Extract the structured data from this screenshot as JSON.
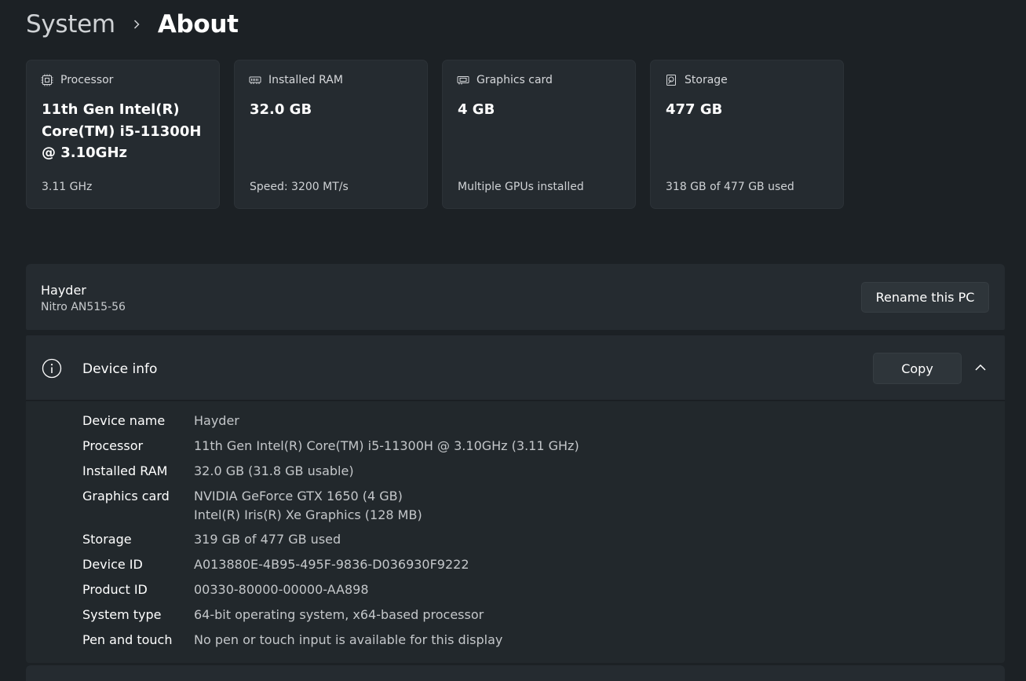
{
  "breadcrumb": {
    "parent": "System",
    "current": "About"
  },
  "cards": [
    {
      "label": "Processor",
      "value": "11th Gen Intel(R) Core(TM) i5-11300H @ 3.10GHz",
      "sub": "3.11 GHz",
      "icon": "processor-icon"
    },
    {
      "label": "Installed RAM",
      "value": "32.0 GB",
      "sub": "Speed: 3200 MT/s",
      "icon": "ram-icon"
    },
    {
      "label": "Graphics card",
      "value": "4 GB",
      "sub": "Multiple GPUs installed",
      "icon": "graphics-card-icon"
    },
    {
      "label": "Storage",
      "value": "477 GB",
      "sub": "318 GB of 477 GB used",
      "icon": "storage-icon"
    }
  ],
  "pc": {
    "name": "Hayder",
    "model": "Nitro AN515-56",
    "rename_label": "Rename this PC"
  },
  "device_info": {
    "title": "Device info",
    "copy_label": "Copy",
    "rows": [
      {
        "label": "Device name",
        "value": "Hayder"
      },
      {
        "label": "Processor",
        "value": "11th Gen Intel(R) Core(TM) i5-11300H @ 3.10GHz (3.11 GHz)"
      },
      {
        "label": "Installed RAM",
        "value": "32.0 GB (31.8 GB usable)"
      },
      {
        "label": "Graphics card",
        "value": "NVIDIA GeForce GTX 1650 (4 GB)",
        "value2": "Intel(R) Iris(R) Xe Graphics (128 MB)"
      },
      {
        "label": "Storage",
        "value": "319 GB of 477 GB used"
      },
      {
        "label": "Device ID",
        "value": "A013880E-4B95-495F-9836-D036930F9222"
      },
      {
        "label": "Product ID",
        "value": "00330-80000-00000-AA898"
      },
      {
        "label": "System type",
        "value": "64-bit operating system, x64-based processor"
      },
      {
        "label": "Pen and touch",
        "value": "No pen or touch input is available for this display"
      }
    ]
  }
}
